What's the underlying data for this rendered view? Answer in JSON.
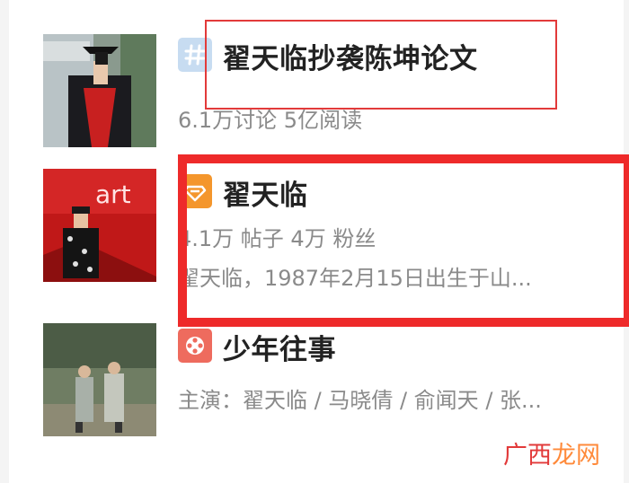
{
  "results": [
    {
      "type": "topic",
      "icon": "hashtag-topic-icon",
      "title": "翟天临抄袭陈坤论文",
      "meta": "6.1万讨论 5亿阅读"
    },
    {
      "type": "forum",
      "icon": "forum-diamond-icon",
      "title": "翟天临",
      "meta": "4.1万 帖子 4万 粉丝",
      "desc": "翟天临，1987年2月15日出生于山..."
    },
    {
      "type": "video",
      "icon": "film-reel-icon",
      "title": "少年往事",
      "meta": "主演：翟天临 / 马晓倩 / 俞闻天 / 张..."
    }
  ],
  "watermark": {
    "part1": "广西",
    "part2": "龙网"
  },
  "colors": {
    "highlight": "#e23a3a",
    "topic_icon": "#c7dcf1",
    "forum_icon": "#f4962c",
    "video_icon": "#ee6b5e"
  }
}
